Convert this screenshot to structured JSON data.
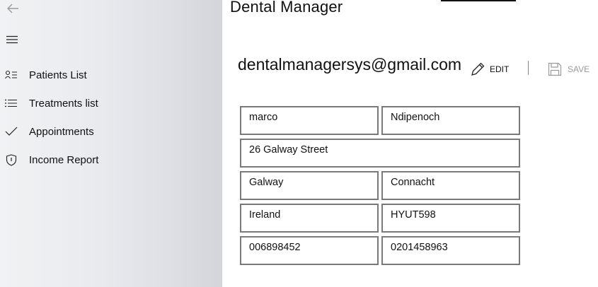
{
  "app": {
    "title": "Dental Manager"
  },
  "nav": {
    "items": [
      {
        "label": "Patients List",
        "icon": "contact-list-icon"
      },
      {
        "label": "Treatments list",
        "icon": "bulleted-list-icon"
      },
      {
        "label": "Appointments",
        "icon": "checkmark-icon"
      },
      {
        "label": "Income Report",
        "icon": "shield-icon"
      }
    ]
  },
  "account": {
    "email": "dentalmanagersys@gmail.com"
  },
  "toolbar": {
    "edit_label": "EDIT",
    "save_label": "SAVE"
  },
  "form": {
    "first_name": "marco",
    "last_name": "Ndipenoch",
    "address": "26 Galway Street",
    "city": "Galway",
    "province": "Connacht",
    "country": "Ireland",
    "postcode": "HYUT598",
    "phone": "006898452",
    "mobile": "0201458963"
  },
  "colors": {
    "text": "#111111",
    "field_border": "#7a7a7a",
    "disabled_text": "#9a9a9a",
    "sidebar_bg": "#e6e7eb"
  }
}
